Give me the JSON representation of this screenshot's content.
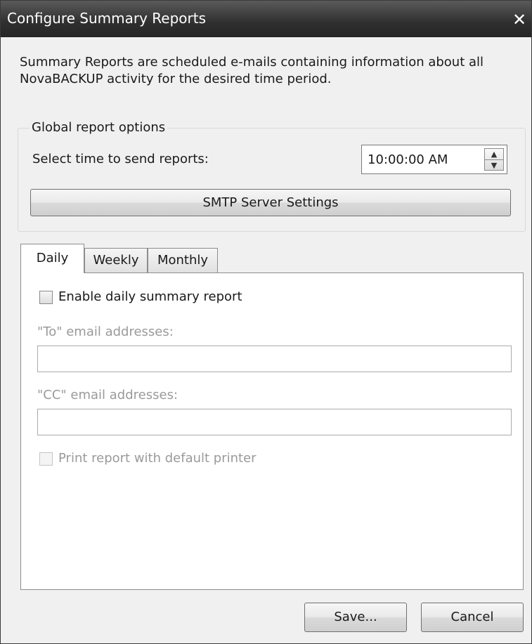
{
  "window": {
    "title": "Configure Summary Reports",
    "close_glyph": "✕"
  },
  "description": "Summary Reports are scheduled e-mails containing information about all NovaBACKUP activity for the desired time period.",
  "global_options": {
    "group_title": "Global report options",
    "time_label": "Select time to send reports:",
    "time_value": "10:00:00 AM",
    "smtp_button": "SMTP Server Settings"
  },
  "tabs": [
    {
      "label": "Daily",
      "active": true
    },
    {
      "label": "Weekly",
      "active": false
    },
    {
      "label": "Monthly",
      "active": false
    }
  ],
  "daily": {
    "enable_label": "Enable daily summary report",
    "enable_checked": false,
    "to_label": "\"To\" email addresses:",
    "to_value": "",
    "cc_label": "\"CC\" email addresses:",
    "cc_value": "",
    "print_label": "Print report with default printer",
    "print_checked": false
  },
  "footer": {
    "save": "Save...",
    "cancel": "Cancel"
  },
  "colors": {
    "titlebar": "#2f2f2f",
    "dialog_bg": "#f0f0f0",
    "disabled_text": "#9a9a9a"
  }
}
